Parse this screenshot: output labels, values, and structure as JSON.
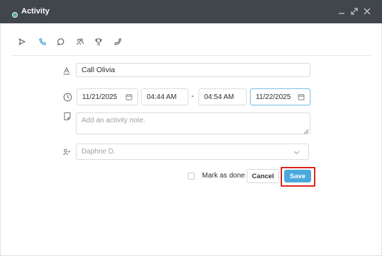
{
  "window": {
    "title": "Activity",
    "controls": [
      "minimize-icon",
      "maximize-icon",
      "close-icon"
    ]
  },
  "activity_types": [
    {
      "icon": "send-icon",
      "selected": false
    },
    {
      "icon": "phone-icon",
      "selected": true
    },
    {
      "icon": "chat-bubble-icon",
      "selected": false
    },
    {
      "icon": "meeting-people-icon",
      "selected": false
    },
    {
      "icon": "trophy-icon",
      "selected": false
    },
    {
      "icon": "phone-outline-icon",
      "selected": false
    }
  ],
  "form": {
    "subject": "Call Olivia",
    "start_date": "11/21/2025",
    "start_time": "04:44 AM",
    "range_separator": "-",
    "end_time": "04:54 AM",
    "end_date": "11/22/2025",
    "note_placeholder": "Add an activity note.",
    "assignee": "Daphne D."
  },
  "footer": {
    "mark_as_done_label": "Mark as done",
    "mark_as_done_checked": false,
    "cancel_label": "Cancel",
    "save_label": "Save"
  },
  "colors": {
    "titlebar": "#41454c",
    "accent": "#4aa8dc",
    "highlight": "#d9261c",
    "status_dot": "#56b08c"
  }
}
